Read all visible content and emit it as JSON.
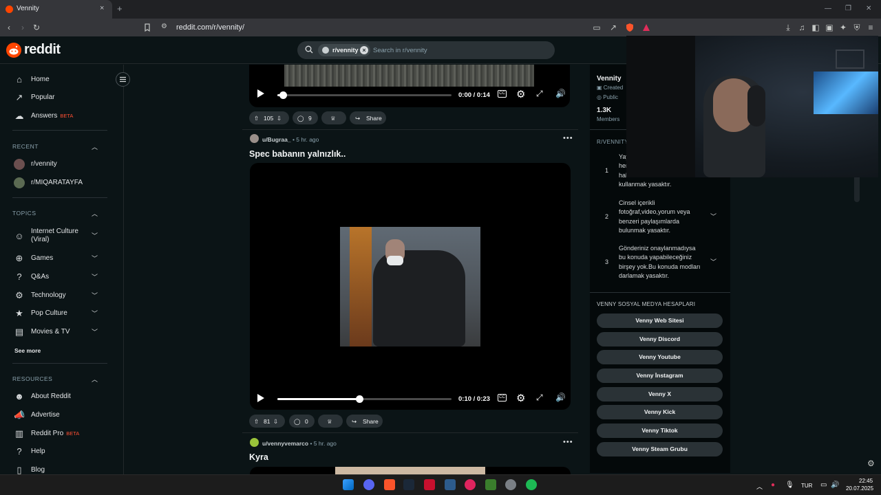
{
  "browser": {
    "tab_title": "Vennity",
    "tab_close": "×",
    "new_tab": "+",
    "url": "reddit.com/r/vennity/",
    "window_controls": [
      "—",
      "❐",
      "✕"
    ]
  },
  "header": {
    "logo_text": "reddit",
    "search_chip": "r/vennity",
    "search_placeholder": "Search in r/vennity"
  },
  "sidebar": {
    "main": [
      {
        "label": "Home",
        "icon": "home-icon"
      },
      {
        "label": "Popular",
        "icon": "popular-icon"
      },
      {
        "label": "Answers",
        "icon": "answers-icon",
        "badge": "BETA"
      }
    ],
    "recent_title": "RECENT",
    "recent": [
      {
        "label": "r/vennity"
      },
      {
        "label": "r/MIQARATAYFA"
      }
    ],
    "topics_title": "TOPICS",
    "topics": [
      {
        "label_line1": "Internet Culture",
        "label_line2": "(Viral)"
      },
      {
        "label": "Games"
      },
      {
        "label": "Q&As"
      },
      {
        "label": "Technology"
      },
      {
        "label": "Pop Culture"
      },
      {
        "label": "Movies & TV"
      }
    ],
    "see_more": "See more",
    "resources_title": "RESOURCES",
    "resources": [
      {
        "label": "About Reddit"
      },
      {
        "label": "Advertise"
      },
      {
        "label": "Reddit Pro",
        "badge": "BETA"
      },
      {
        "label": "Help"
      },
      {
        "label": "Blog"
      }
    ]
  },
  "feed": {
    "post0": {
      "time_display": "0:00 / 0:14",
      "progress": 0.03,
      "upvotes": "105",
      "comments": "9",
      "share": "Share"
    },
    "post1": {
      "author": "u/Bugraa_",
      "time": "• 5 hr. ago",
      "title": "Spec babanın yalnızlık..",
      "time_display": "0:10 / 0:23",
      "progress": 0.47,
      "upvotes": "81",
      "comments": "0",
      "share": "Share"
    },
    "post2": {
      "author": "u/vennyvemarco",
      "time": "• 5 hr. ago",
      "title": "Kyra"
    }
  },
  "right_sidebar": {
    "name": "Vennity",
    "created": "Created",
    "public": "Public",
    "members_count": "1.3K",
    "members_label": "Members",
    "rules_title": "R/VENNITY",
    "rules": [
      {
        "num": "1",
        "lines": [
          "Yay",
          "herh",
          "hakaret k",
          "kullanmak yasaktır."
        ]
      },
      {
        "num": "2",
        "lines": [
          "Cinsel içerikli",
          "fotoğraf,video,yorum veya",
          "benzeri paylaşımlarda",
          "bulunmak yasaktır."
        ]
      },
      {
        "num": "3",
        "lines": [
          "Gönderiniz onaylanmadıysa",
          "bu konuda yapabileceğiniz",
          "birşey yok.Bu konuda modları",
          "darlamak yasaktır."
        ]
      }
    ],
    "social_title": "VENNY SOSYAL MEDYA HESAPLARI",
    "social_buttons": [
      "Venny Web Sitesi",
      "Venny Discord",
      "Venny Youtube",
      "Venny İnstagram",
      "Venny X",
      "Venny Kick",
      "Venny Tiktok",
      "Venny Steam Grubu"
    ]
  },
  "taskbar": {
    "lang": "TUR",
    "time": "22:45",
    "date": "20.07.2025"
  },
  "colors": {
    "accent": "#ff4500",
    "beta": "#ff4f32"
  }
}
